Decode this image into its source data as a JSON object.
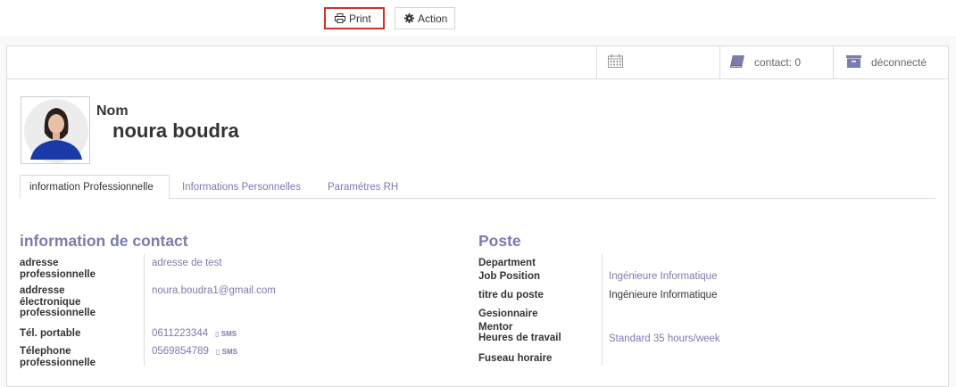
{
  "toolbar": {
    "print_label": "Print",
    "action_label": "Action"
  },
  "button_box": {
    "contact_label": "contact: 0",
    "status_label": "déconnecté"
  },
  "employee": {
    "name_label": "Nom",
    "name": "noura boudra"
  },
  "tabs": [
    "information Professionnelle",
    "Informations Personnelles",
    "Paramétres RH"
  ],
  "contact_section": {
    "title": "information de contact",
    "work_address_label": "adresse professionnelle",
    "work_address": "adresse de test",
    "work_email_label": "addresse électronique professionnelle",
    "work_email": "noura.boudra1@gmail.com",
    "mobile_label": "Tél. portable",
    "mobile": "0611223344",
    "work_phone_label": "Télephone professionnelle",
    "work_phone": "0569854789",
    "sms_label": "SMS"
  },
  "position_section": {
    "title": "Poste",
    "department_label": "Department",
    "job_position_label": "Job Position",
    "job_position": "Ingénieure Informatique",
    "job_title_label": "titre du poste",
    "job_title": "Ingénieure Informatique",
    "manager_label": "Gesionnaire",
    "mentor_label": "Mentor",
    "working_hours_label": "Heures de travail",
    "working_hours": "Standard 35 hours/week",
    "timezone_label": "Fuseau horaire"
  }
}
